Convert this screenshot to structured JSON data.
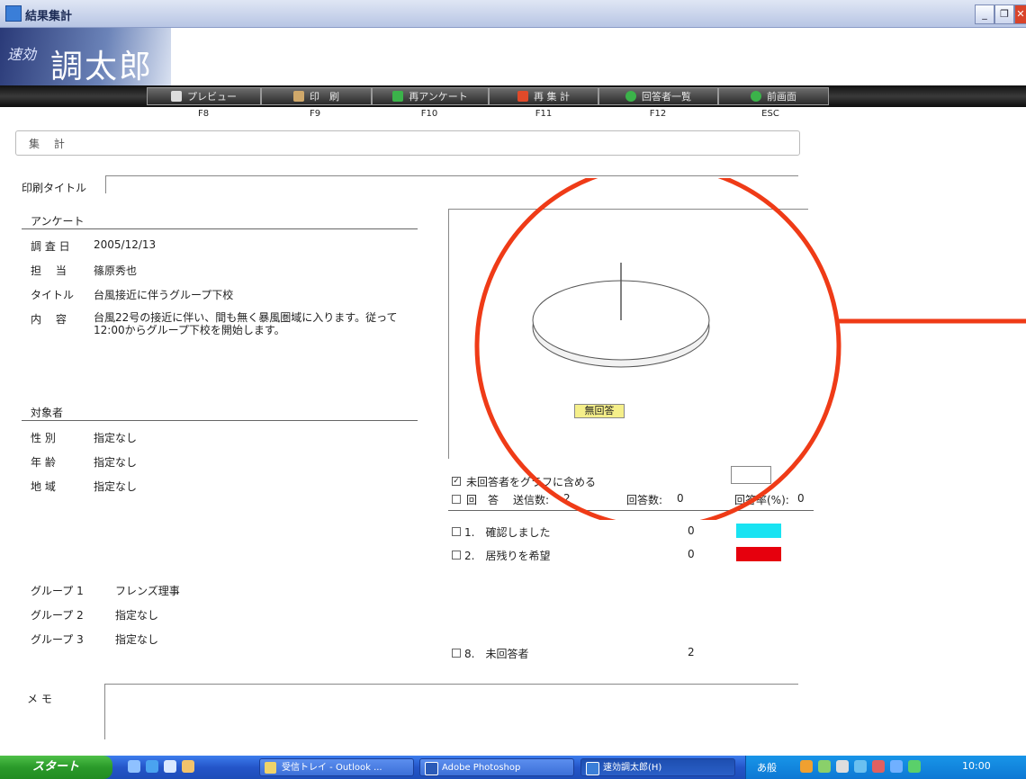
{
  "window": {
    "title": "結果集計"
  },
  "window_controls": {
    "minimize": "_",
    "restore": "❐",
    "close": "✕"
  },
  "logo": {
    "sub": "速効",
    "main": "調太郎"
  },
  "toolbar": {
    "buttons": [
      {
        "label": "プレビュー",
        "key": "F8"
      },
      {
        "label": "印　刷",
        "key": "F9"
      },
      {
        "label": "再アンケート",
        "key": "F10"
      },
      {
        "label": "再 集 計",
        "key": "F11"
      },
      {
        "label": "回答者一覧",
        "key": "F12"
      },
      {
        "label": "前画面",
        "key": "ESC"
      }
    ]
  },
  "section": {
    "title": "集 計"
  },
  "print_title": {
    "label": "印刷タイトル",
    "value": ""
  },
  "survey": {
    "heading": "アンケート",
    "rows": [
      {
        "label": "調 査 日",
        "value": "2005/12/13"
      },
      {
        "label": "担　 当",
        "value": "篠原秀也"
      },
      {
        "label": "タイトル",
        "value": "台風接近に伴うグループ下校"
      },
      {
        "label": "内　 容",
        "value": "台風22号の接近に伴い、間も無く暴風圏域に入ります。従って12:00からグループ下校を開始します。"
      }
    ]
  },
  "target": {
    "heading": "対象者",
    "rows": [
      {
        "label": "性 別",
        "value": "指定なし"
      },
      {
        "label": "年 齢",
        "value": "指定なし"
      },
      {
        "label": "地 域",
        "value": "指定なし"
      }
    ]
  },
  "groups": [
    {
      "label": "グループ 1",
      "value": "フレンズ理事"
    },
    {
      "label": "グループ 2",
      "value": "指定なし"
    },
    {
      "label": "グループ 3",
      "value": "指定なし"
    }
  ],
  "memo": {
    "label": "メ モ",
    "value": ""
  },
  "chart_data": {
    "type": "pie",
    "categories": [
      "無回答"
    ],
    "values": [
      2
    ],
    "slice_label": "無回答"
  },
  "include_unanswered": {
    "label": "未回答者をグラフに含める",
    "checked": true
  },
  "stats": {
    "answer_label": "回　答",
    "sent_label": "送信数:",
    "sent": "2",
    "answered_label": "回答数:",
    "answered": "0",
    "rate_label": "回答率(%):",
    "rate": "0"
  },
  "options": [
    {
      "label": "1.　確認しました",
      "count": "0",
      "color": "#19e3f2"
    },
    {
      "label": "2.　居残りを希望",
      "count": "0",
      "color": "#e6000d"
    }
  ],
  "unanswered_row": {
    "label": "8.　未回答者",
    "count": "2"
  },
  "annotation": {
    "color": "#ef3b17"
  },
  "taskbar": {
    "start_label": "スタート",
    "tasks": [
      {
        "label": "受信トレイ - Outlook ..."
      },
      {
        "label": "Adobe Photoshop"
      },
      {
        "label": "速効調太郎(H)"
      }
    ],
    "tray_text": "あ般",
    "clock": "10:00"
  }
}
